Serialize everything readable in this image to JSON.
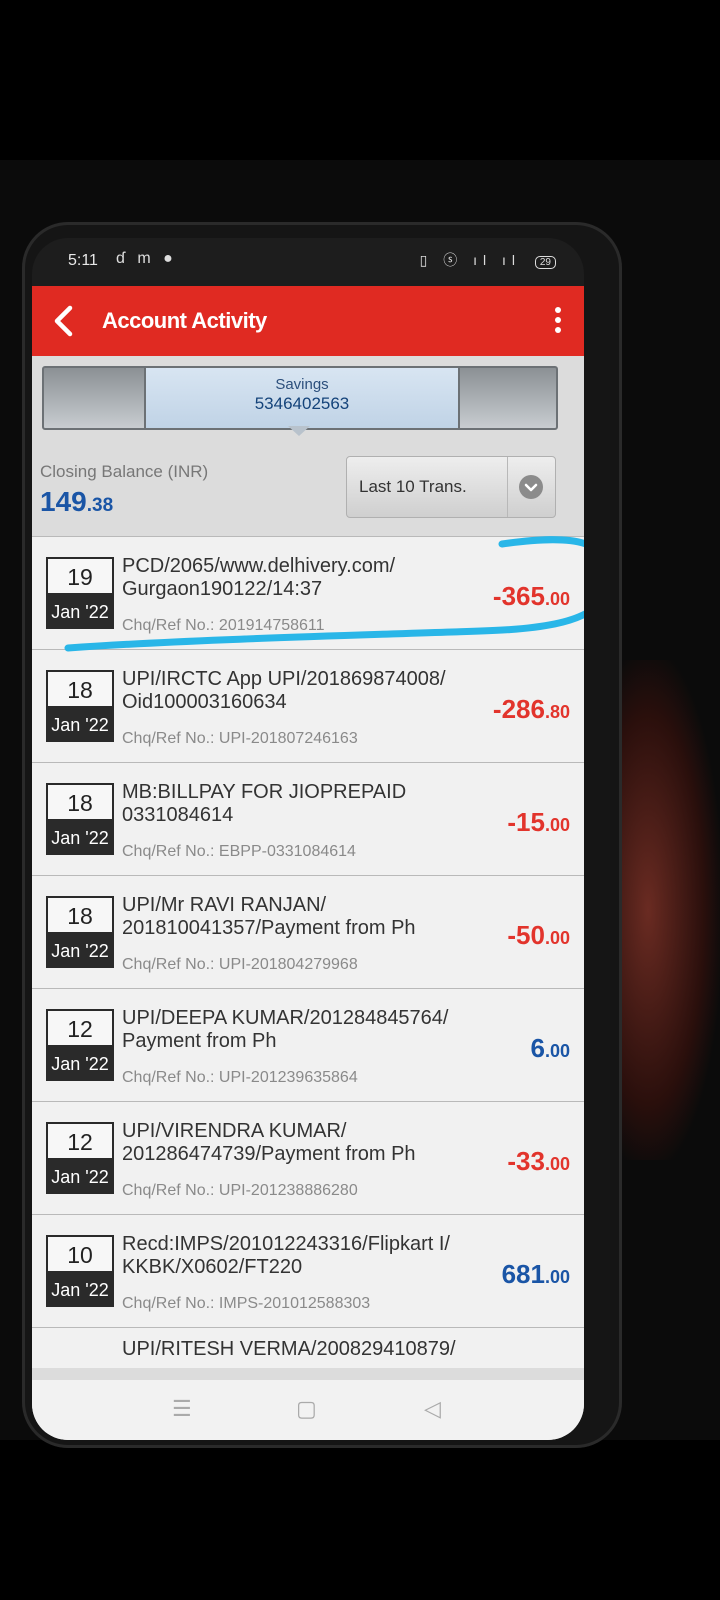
{
  "status_bar": {
    "time": "5:11",
    "left_icons": "ɗ m ●",
    "right_icons": "▯ ⓢ ıl ıl",
    "battery": "29"
  },
  "app_bar": {
    "title": "Account Activity"
  },
  "account": {
    "type": "Savings",
    "number": "5346402563"
  },
  "balance": {
    "label": "Closing Balance (INR)",
    "whole": "149",
    "fraction": ".38"
  },
  "filter": {
    "selected": "Last 10 Trans."
  },
  "transactions": [
    {
      "day": "19",
      "month": "Jan '22",
      "line1": "PCD/2065/www.delhivery.com/",
      "line2": "Gurgaon190122/14:37",
      "ref": "Chq/Ref No.: 201914758611",
      "amount_whole": "-365",
      "amount_cents": ".00",
      "type": "debit"
    },
    {
      "day": "18",
      "month": "Jan '22",
      "line1": "UPI/IRCTC App UPI/201869874008/",
      "line2": "Oid100003160634",
      "ref": "Chq/Ref No.: UPI-201807246163",
      "amount_whole": "-286",
      "amount_cents": ".80",
      "type": "debit"
    },
    {
      "day": "18",
      "month": "Jan '22",
      "line1": "MB:BILLPAY FOR JIOPREPAID",
      "line2": "0331084614",
      "ref": "Chq/Ref No.: EBPP-0331084614",
      "amount_whole": "-15",
      "amount_cents": ".00",
      "type": "debit"
    },
    {
      "day": "18",
      "month": "Jan '22",
      "line1": "UPI/Mr RAVI  RANJAN/",
      "line2": "201810041357/Payment from Ph",
      "ref": "Chq/Ref No.: UPI-201804279968",
      "amount_whole": "-50",
      "amount_cents": ".00",
      "type": "debit"
    },
    {
      "day": "12",
      "month": "Jan '22",
      "line1": "UPI/DEEPA KUMAR/201284845764/",
      "line2": "Payment from Ph",
      "ref": "Chq/Ref No.: UPI-201239635864",
      "amount_whole": "6",
      "amount_cents": ".00",
      "type": "credit"
    },
    {
      "day": "12",
      "month": "Jan '22",
      "line1": "UPI/VIRENDRA KUMAR/",
      "line2": "201286474739/Payment from Ph",
      "ref": "Chq/Ref No.: UPI-201238886280",
      "amount_whole": "-33",
      "amount_cents": ".00",
      "type": "debit"
    },
    {
      "day": "10",
      "month": "Jan '22",
      "line1": "Recd:IMPS/201012243316/Flipkart I/",
      "line2": "KKBK/X0602/FT220",
      "ref": "Chq/Ref No.: IMPS-201012588303",
      "amount_whole": "681",
      "amount_cents": ".00",
      "type": "credit"
    }
  ],
  "partial_row": {
    "line1": "UPI/RITESH VERMA/200829410879/"
  },
  "colors": {
    "app_bar": "#e02a22",
    "debit": "#e2342c",
    "credit": "#1a55a6",
    "highlight": "#29b6e8"
  },
  "icons": {
    "back": "back-arrow-icon",
    "menu": "kebab-menu-icon",
    "dropdown": "chevron-down-icon",
    "nav_recents": "recents-icon",
    "nav_home": "home-icon",
    "nav_back": "nav-back-icon"
  }
}
